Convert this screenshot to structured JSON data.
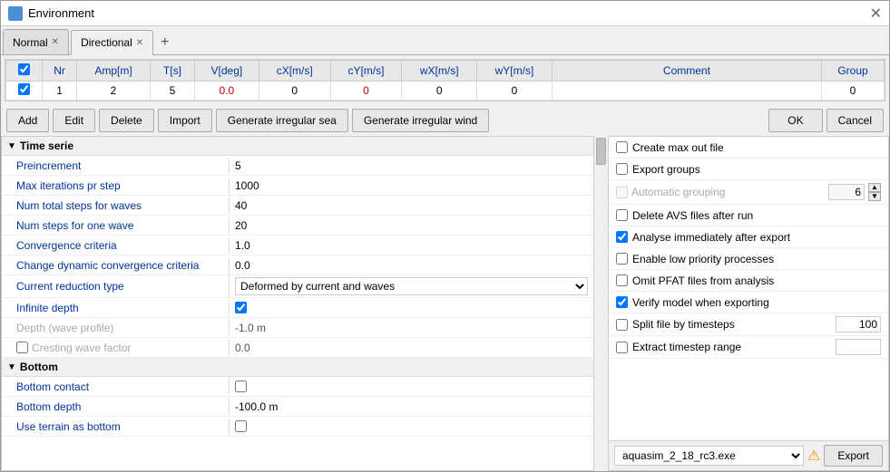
{
  "window": {
    "title": "Environment",
    "icon": "environment-icon"
  },
  "tabs": [
    {
      "id": "normal",
      "label": "Normal",
      "active": false,
      "closeable": true
    },
    {
      "id": "directional",
      "label": "Directional",
      "active": true,
      "closeable": true
    }
  ],
  "tab_add_label": "+",
  "table": {
    "columns": [
      "",
      "Nr",
      "Amp[m]",
      "T[s]",
      "V[deg]",
      "cX[m/s]",
      "cY[m/s]",
      "wX[m/s]",
      "wY[m/s]",
      "Comment",
      "Group"
    ],
    "rows": [
      {
        "checked": true,
        "nr": "1",
        "amp": "2",
        "t": "5",
        "v": "0.0",
        "cx": "0",
        "cy": "0",
        "wx": "0",
        "wy": "0",
        "comment": "",
        "group": "0"
      }
    ]
  },
  "buttons": {
    "add": "Add",
    "edit": "Edit",
    "delete": "Delete",
    "import": "Import",
    "gen_irregular_sea": "Generate irregular sea",
    "gen_irregular_wind": "Generate irregular wind",
    "ok": "OK",
    "cancel": "Cancel"
  },
  "left_panel": {
    "sections": [
      {
        "id": "time_serie",
        "label": "Time serie",
        "properties": [
          {
            "label": "Preincrement",
            "value": "5",
            "type": "text",
            "disabled": false
          },
          {
            "label": "Max iterations pr step",
            "value": "1000",
            "type": "text",
            "disabled": false
          },
          {
            "label": "Num total steps for waves",
            "value": "40",
            "type": "text",
            "disabled": false
          },
          {
            "label": "Num steps for one wave",
            "value": "20",
            "type": "text",
            "disabled": false
          },
          {
            "label": "Convergence criteria",
            "value": "1.0",
            "type": "text",
            "disabled": false
          },
          {
            "label": "Change dynamic convergence criteria",
            "value": "0.0",
            "type": "text",
            "disabled": false
          },
          {
            "label": "Current reduction type",
            "value": "Deformed by current and waves",
            "type": "select",
            "disabled": false,
            "options": [
              "Deformed by current and waves"
            ]
          },
          {
            "label": "Infinite depth",
            "value": "",
            "type": "checkbox",
            "checked": true,
            "disabled": false
          },
          {
            "label": "Depth (wave profile)",
            "value": "-1.0 m",
            "type": "text",
            "disabled": true
          },
          {
            "label": "Cresting wave factor",
            "value": "0.0",
            "type": "text",
            "disabled": true,
            "hasCheckbox": true
          }
        ]
      },
      {
        "id": "bottom",
        "label": "Bottom",
        "properties": [
          {
            "label": "Bottom contact",
            "value": "",
            "type": "checkbox",
            "checked": false,
            "disabled": false
          },
          {
            "label": "Bottom depth",
            "value": "-100.0 m",
            "type": "text",
            "disabled": false
          },
          {
            "label": "Use terrain as bottom",
            "value": "",
            "type": "checkbox",
            "checked": false,
            "disabled": false
          }
        ]
      }
    ]
  },
  "right_panel": {
    "items": [
      {
        "id": "create_max_out",
        "label": "Create max out file",
        "checked": false,
        "type": "checkbox",
        "disabled": false
      },
      {
        "id": "export_groups",
        "label": "Export groups",
        "checked": false,
        "type": "checkbox",
        "disabled": false
      },
      {
        "id": "auto_grouping",
        "label": "Automatic grouping",
        "checked": false,
        "type": "checkbox_with_input",
        "disabled": true,
        "input_value": "6"
      },
      {
        "id": "delete_avs",
        "label": "Delete AVS files after run",
        "checked": false,
        "type": "checkbox",
        "disabled": false
      },
      {
        "id": "analyse_immediately",
        "label": "Analyse immediately after export",
        "checked": true,
        "type": "checkbox",
        "disabled": false
      },
      {
        "id": "enable_low_priority",
        "label": "Enable low priority processes",
        "checked": false,
        "type": "checkbox",
        "disabled": false
      },
      {
        "id": "omit_pfat",
        "label": "Omit PFAT files from analysis",
        "checked": false,
        "type": "checkbox",
        "disabled": false
      },
      {
        "id": "verify_model",
        "label": "Verify model when exporting",
        "checked": true,
        "type": "checkbox",
        "disabled": false
      },
      {
        "id": "split_by_timesteps",
        "label": "Split file by timesteps",
        "checked": false,
        "type": "checkbox_with_input",
        "disabled": false,
        "input_value": "100"
      },
      {
        "id": "extract_timestep",
        "label": "Extract timestep range",
        "checked": false,
        "type": "checkbox_with_input",
        "disabled": false,
        "input_value": ""
      }
    ],
    "exe_select": "aquasim_2_18_rc3.exe",
    "export_label": "Export",
    "warn_symbol": "⚠"
  }
}
